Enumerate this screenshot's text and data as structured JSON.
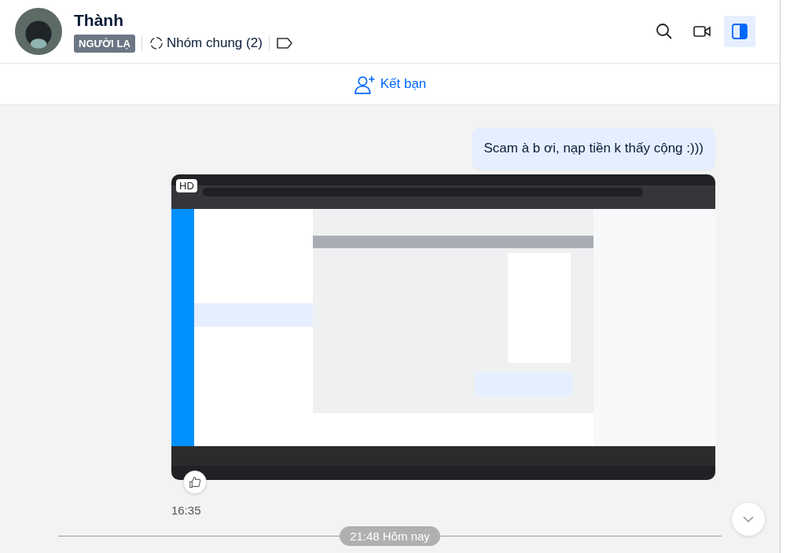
{
  "header": {
    "name": "Thành",
    "badge": "NGƯỜI LẠ",
    "groups": "Nhóm chung (2)"
  },
  "header_actions": [
    {
      "kind": "search",
      "selected": false
    },
    {
      "kind": "video",
      "selected": false
    },
    {
      "kind": "panel",
      "selected": true
    }
  ],
  "add_friend": "Kết bạn",
  "message": {
    "text": "Scam à b ơi, nạp tiền k thấy cộng :)))"
  },
  "image_message": {
    "kind": "picture",
    "badge": "HD",
    "time": "16:35"
  },
  "date_divider": "21:48 Hôm nay"
}
